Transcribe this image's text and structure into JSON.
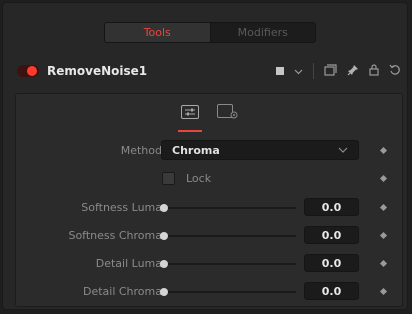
{
  "tabs": [
    {
      "label": "Tools",
      "active": true
    },
    {
      "label": "Modifiers",
      "active": false
    }
  ],
  "node": {
    "name": "RemoveNoise1",
    "enabled": true,
    "header_icons": [
      "color-swatch-icon",
      "chevron-down-icon",
      "copy-icon",
      "pin-icon",
      "lock-icon",
      "reset-icon"
    ]
  },
  "subtabs": [
    {
      "icon": "sliders-icon",
      "active": true
    },
    {
      "icon": "settings-icon",
      "active": false
    }
  ],
  "controls": {
    "method": {
      "label": "Method",
      "value": "Chroma"
    },
    "lock": {
      "label": "Lock",
      "checked": false
    },
    "softness_luma": {
      "label": "Softness Luma",
      "value": "0.0",
      "fraction": 0.0
    },
    "softness_chroma": {
      "label": "Softness Chroma",
      "value": "0.0",
      "fraction": 0.0
    },
    "detail_luma": {
      "label": "Detail Luma",
      "value": "0.0",
      "fraction": 0.0
    },
    "detail_chroma": {
      "label": "Detail Chroma",
      "value": "0.0",
      "fraction": 0.0
    }
  },
  "colors": {
    "accent": "#e6473c",
    "toggle_on": "#ff3b2f"
  }
}
